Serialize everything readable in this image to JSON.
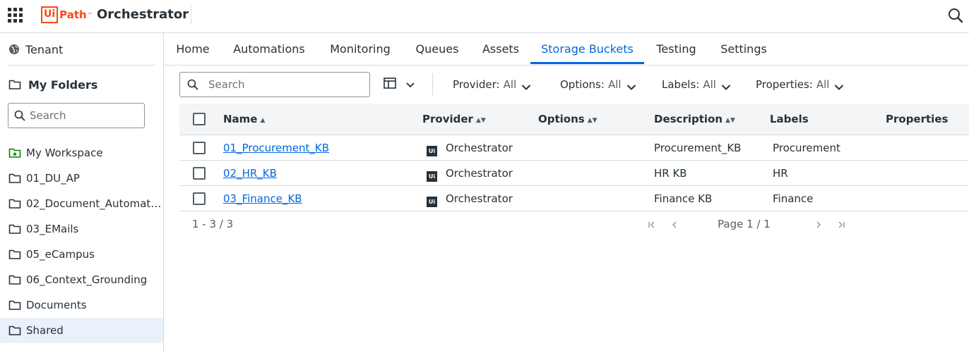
{
  "header": {
    "logo_ui": "Ui",
    "logo_path": "Path",
    "logo_tm": "™",
    "product": "Orchestrator"
  },
  "sidebar": {
    "tenant_label": "Tenant",
    "my_folders_label": "My Folders",
    "search_placeholder": "Search",
    "folders": [
      {
        "label": "My Workspace",
        "icon": "workspace-folder-icon"
      },
      {
        "label": "01_DU_AP",
        "icon": "folder-icon"
      },
      {
        "label": "02_Document_Automati...",
        "icon": "folder-icon"
      },
      {
        "label": "03_EMails",
        "icon": "folder-icon"
      },
      {
        "label": "05_eCampus",
        "icon": "folder-icon"
      },
      {
        "label": "06_Context_Grounding",
        "icon": "folder-icon"
      },
      {
        "label": "Documents",
        "icon": "folder-icon"
      },
      {
        "label": "Shared",
        "icon": "folder-icon"
      }
    ],
    "selected": "Shared"
  },
  "tabs": [
    {
      "label": "Home"
    },
    {
      "label": "Automations"
    },
    {
      "label": "Monitoring"
    },
    {
      "label": "Queues"
    },
    {
      "label": "Assets"
    },
    {
      "label": "Storage Buckets"
    },
    {
      "label": "Testing"
    },
    {
      "label": "Settings"
    }
  ],
  "active_tab": "Storage Buckets",
  "toolbar": {
    "search_placeholder": "Search",
    "filters": [
      {
        "name": "Provider:",
        "value": "All"
      },
      {
        "name": "Options:",
        "value": "All"
      },
      {
        "name": "Labels:",
        "value": "All"
      },
      {
        "name": "Properties:",
        "value": "All"
      }
    ]
  },
  "grid": {
    "columns": [
      "Name",
      "Provider",
      "Options",
      "Description",
      "Labels",
      "Properties"
    ],
    "sort_indicator": "▲",
    "sortable_indicator": "▲▼",
    "rows": [
      {
        "name": "01_Procurement_KB",
        "provider_badge": "Ui",
        "provider": "Orchestrator",
        "options": "",
        "description": "Procurement_KB",
        "labels": "Procurement",
        "properties": ""
      },
      {
        "name": "02_HR_KB",
        "provider_badge": "Ui",
        "provider": "Orchestrator",
        "options": "",
        "description": "HR KB",
        "labels": "HR",
        "properties": ""
      },
      {
        "name": "03_Finance_KB",
        "provider_badge": "Ui",
        "provider": "Orchestrator",
        "options": "",
        "description": "Finance KB",
        "labels": "Finance",
        "properties": ""
      }
    ]
  },
  "footer": {
    "range": "1 - 3 / 3",
    "page": "Page 1 / 1"
  },
  "colors": {
    "accent": "#0067df",
    "brand": "#fa4616",
    "text": "#273139",
    "selected_bg": "#e9f1fa",
    "border": "#d4dbe0"
  }
}
